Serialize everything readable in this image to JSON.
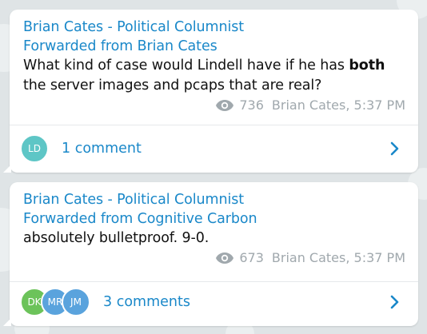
{
  "colors": {
    "accent": "#1a88c9",
    "meta_text": "#a0a8ad",
    "bubble_bg": "#ffffff",
    "chat_bg": "#dfe4e6"
  },
  "messages": [
    {
      "author": "Brian Cates - Political Columnist",
      "forwarded": "Forwarded from Brian Cates",
      "text_before_bold": "What kind of case would Lindell have if he has ",
      "text_bold": "both",
      "text_after_bold": " the server images and pcaps that are real?",
      "views_icon": "eye-icon",
      "views": "736",
      "signature": "Brian Cates, 5:37 PM",
      "comments_label": "1 comment",
      "avatars": [
        {
          "initials": "LD",
          "color": "#5ec6c6"
        }
      ]
    },
    {
      "author": "Brian Cates - Political Columnist",
      "forwarded": "Forwarded from Cognitive Carbon",
      "text_before_bold": "absolutely bulletproof. 9-0.",
      "text_bold": "",
      "text_after_bold": "",
      "views_icon": "eye-icon",
      "views": "673",
      "signature": "Brian Cates, 5:37 PM",
      "comments_label": "3 comments",
      "avatars": [
        {
          "initials": "DK",
          "color": "#6cc35a"
        },
        {
          "initials": "MR",
          "color": "#5aa3dd"
        },
        {
          "initials": "JM",
          "color": "#5aa3dd"
        }
      ]
    }
  ]
}
